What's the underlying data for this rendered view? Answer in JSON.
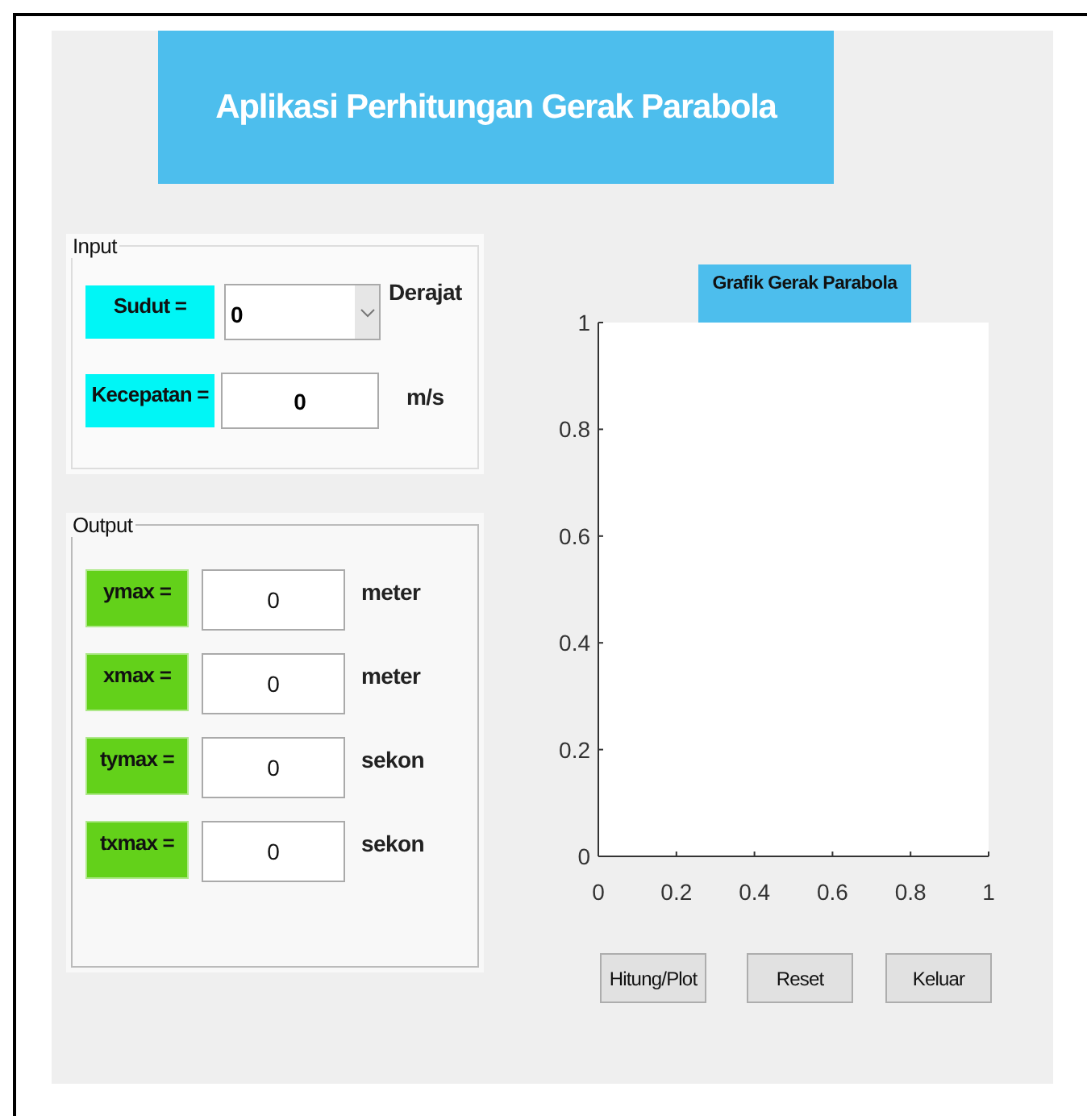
{
  "title": "Aplikasi Perhitungan Gerak Parabola",
  "input": {
    "legend": "Input",
    "rows": [
      {
        "kind": "dropdown",
        "label": "Sudut =",
        "value": "0",
        "unit": "Derajat"
      },
      {
        "kind": "field",
        "label": "Kecepatan =",
        "value": "0",
        "unit": "m/s"
      }
    ]
  },
  "output": {
    "legend": "Output",
    "rows": [
      {
        "label": "ymax =",
        "value": "0",
        "unit": "meter"
      },
      {
        "label": "xmax =",
        "value": "0",
        "unit": "meter"
      },
      {
        "label": "tymax =",
        "value": "0",
        "unit": "sekon"
      },
      {
        "label": "txmax =",
        "value": "0",
        "unit": "sekon"
      }
    ]
  },
  "chart": {
    "chart_data": {
      "type": "line",
      "title": "Grafik Gerak Parabola",
      "xlim": [
        0,
        1
      ],
      "ylim": [
        0,
        1
      ],
      "xticks": [
        0,
        0.2,
        0.4,
        0.6,
        0.8,
        1
      ],
      "yticks": [
        0,
        0.2,
        0.4,
        0.6,
        0.8,
        1
      ]
    }
  },
  "buttons": [
    "Hitung/Plot",
    "Reset",
    "Keluar"
  ]
}
